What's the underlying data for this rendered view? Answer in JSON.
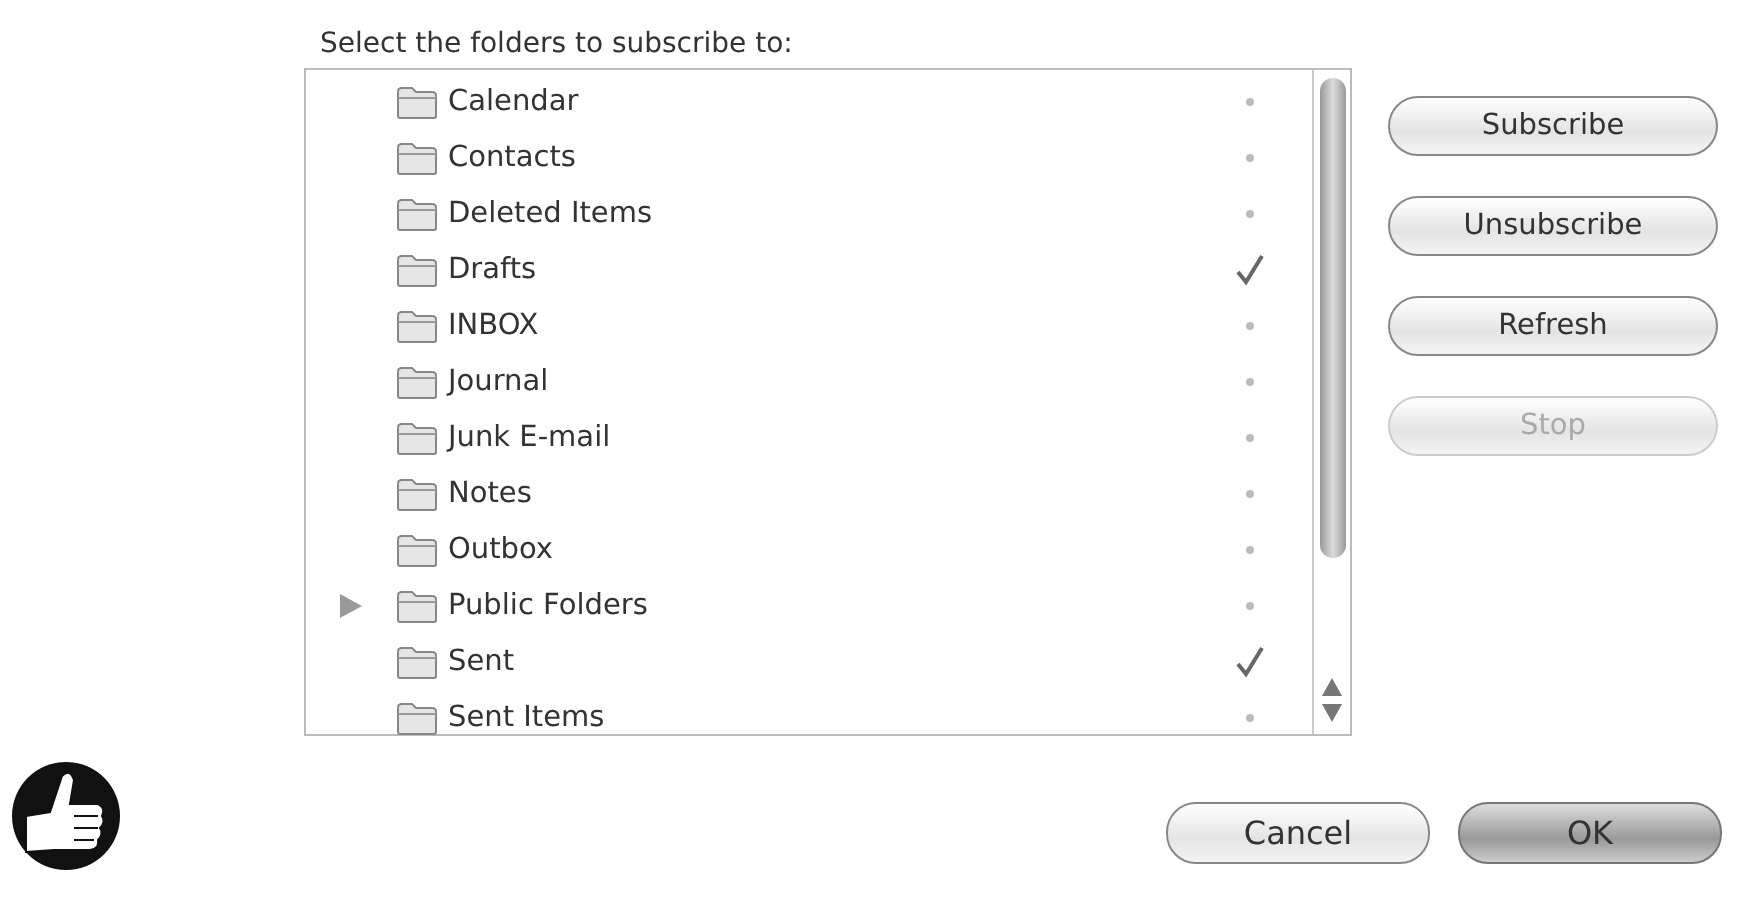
{
  "prompt": "Select the folders to subscribe to:",
  "folders": [
    {
      "name": "Calendar",
      "kind": "folder",
      "subscribed": false
    },
    {
      "name": "Contacts",
      "kind": "folder",
      "subscribed": false
    },
    {
      "name": "Deleted Items",
      "kind": "folder",
      "subscribed": false
    },
    {
      "name": "Drafts",
      "kind": "folder",
      "subscribed": true
    },
    {
      "name": "INBOX",
      "kind": "folder",
      "subscribed": false
    },
    {
      "name": "Journal",
      "kind": "folder",
      "subscribed": false
    },
    {
      "name": "Junk E-mail",
      "kind": "folder",
      "subscribed": false
    },
    {
      "name": "Notes",
      "kind": "folder",
      "subscribed": false
    },
    {
      "name": "Outbox",
      "kind": "folder",
      "subscribed": false
    },
    {
      "name": "Public Folders",
      "kind": "group",
      "subscribed": false
    },
    {
      "name": "Sent",
      "kind": "folder",
      "subscribed": true
    },
    {
      "name": "Sent Items",
      "kind": "folder",
      "subscribed": false
    }
  ],
  "side_buttons": [
    {
      "label": "Subscribe",
      "disabled": false
    },
    {
      "label": "Unsubscribe",
      "disabled": false
    },
    {
      "label": "Refresh",
      "disabled": false
    },
    {
      "label": "Stop",
      "disabled": true
    }
  ],
  "dialog_buttons": [
    {
      "label": "Cancel",
      "default": false
    },
    {
      "label": "OK",
      "default": true
    }
  ]
}
